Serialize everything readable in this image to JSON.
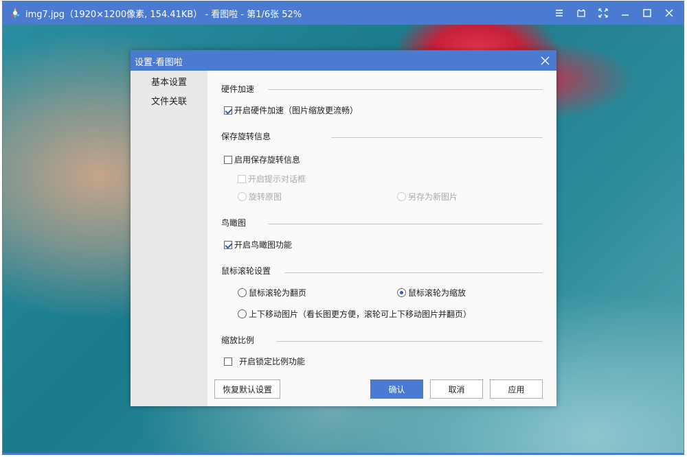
{
  "window": {
    "title": "img7.jpg（1920×1200像素, 154.41KB） - 看图啦 - 第1/6张 52%",
    "controls": [
      "menu-icon",
      "fullscreen-icon",
      "fit-icon",
      "minimize-icon",
      "maximize-icon",
      "close-icon"
    ]
  },
  "dialog": {
    "title": "设置-看图啦",
    "sidebar": [
      {
        "label": "基本设置",
        "selected": true
      },
      {
        "label": "文件关联",
        "selected": false
      }
    ],
    "hardware": {
      "heading": "硬件加速",
      "enable_label": "开启硬件加速（图片缩放更流畅）",
      "enable_checked": true
    },
    "rotation": {
      "heading": "保存旋转信息",
      "enable_label": "启用保存旋转信息",
      "enable_checked": false,
      "prompt_label": "开启提示对话框",
      "rotate_original_label": "旋转原图",
      "save_as_new_label": "另存为新图片"
    },
    "birdseye": {
      "heading": "鸟瞰图",
      "enable_label": "开启鸟瞰图功能",
      "enable_checked": true
    },
    "mouse_wheel": {
      "heading": "鼠标滚轮设置",
      "page_label": "鼠标滚轮为翻页",
      "zoom_label": "鼠标滚轮为缩放",
      "scroll_label": "上下移动图片（看长图更方便，滚轮可上下移动图片并翻页）",
      "selected": "zoom"
    },
    "zoom_ratio": {
      "heading": "缩放比例",
      "lock_label": "开启锁定比例功能",
      "lock_checked": false
    },
    "buttons": {
      "restore": "恢复默认设置",
      "ok": "确认",
      "cancel": "取消",
      "apply": "应用"
    }
  },
  "colors": {
    "accent": "#4a7bd1",
    "sidebar_bg": "#e9e9e9",
    "check": "#2b5fb5"
  }
}
